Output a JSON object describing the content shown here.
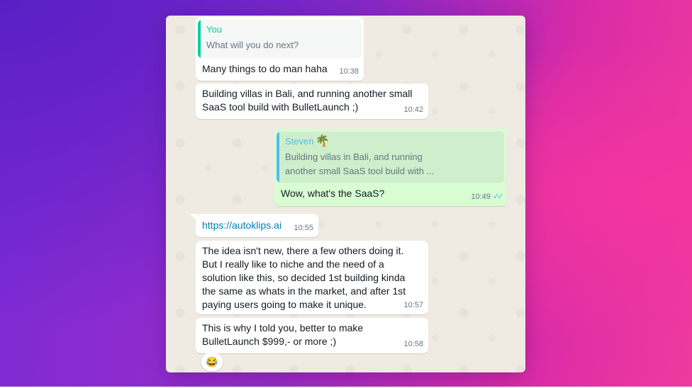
{
  "chat": {
    "messages": [
      {
        "quote_author": "You",
        "quote_text": "What will you do next?",
        "text": "Many things to do man haha",
        "time": "10:38"
      },
      {
        "text": "Building villas in Bali, and running another small\nSaaS tool build with BulletLaunch ;)",
        "time": "10:42"
      },
      {
        "quote_author": "Steven",
        "quote_author_emoji": "🌴",
        "quote_text": "Building villas in Bali, and running\nanother small SaaS tool build with ...",
        "text": "Wow, what's the SaaS?",
        "time": "10:49",
        "status_icon": "double-check-read-icon"
      },
      {
        "text": "https://autoklips.ai",
        "time": "10:55"
      },
      {
        "text": "The idea isn't new, there a few others doing it.\nBut I really like to niche and the need of a\nsolution like this, so decided 1st building kinda\nthe same as whats in the market, and after 1st\npaying users going to make it unique.",
        "time": "10:57"
      },
      {
        "text": "This is why I told you, better to make\nBulletLaunch $999,- or more ;)",
        "time": "10:58",
        "reaction": "😂"
      }
    ]
  },
  "colors": {
    "incoming_bubble": "#ffffff",
    "outgoing_bubble": "#d9fdd3",
    "quote_you_accent": "#06cf9c",
    "quote_steven_accent": "#53bdeb",
    "link": "#027eb5",
    "read_ticks": "#53bdeb"
  }
}
